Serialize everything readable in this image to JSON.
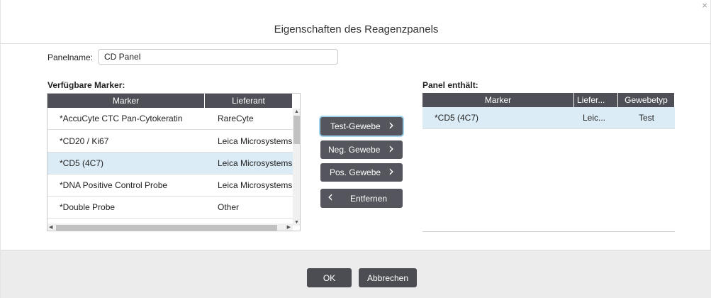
{
  "dialog": {
    "title": "Eigenschaften des Reagenzpanels",
    "close_glyph": "×"
  },
  "panel_name": {
    "label": "Panelname:",
    "value": "CD Panel"
  },
  "available": {
    "label": "Verfügbare Marker:",
    "columns": [
      "Marker",
      "Lieferant"
    ],
    "rows": [
      {
        "marker": "*AccuCyte CTC Pan-Cytokeratin",
        "supplier": "RareCyte",
        "selected": false
      },
      {
        "marker": "*CD20 / Ki67",
        "supplier": "Leica Microsystems",
        "selected": false
      },
      {
        "marker": "*CD5 (4C7)",
        "supplier": "Leica Microsystems",
        "selected": true
      },
      {
        "marker": "*DNA Positive Control Probe",
        "supplier": "Leica Microsystems",
        "selected": false
      },
      {
        "marker": "*Double Probe",
        "supplier": "Other",
        "selected": false
      }
    ]
  },
  "actions": {
    "test": "Test-Gewebe",
    "neg": "Neg. Gewebe",
    "pos": "Pos. Gewebe",
    "remove": "Entfernen",
    "right_chevron": "›",
    "left_chevron": "‹"
  },
  "panel_contains": {
    "label": "Panel enthält:",
    "columns": [
      "Marker",
      "Liefer...",
      "Gewebetyp"
    ],
    "rows": [
      {
        "marker": "*CD5 (4C7)",
        "supplier": "Leic...",
        "tissue": "Test",
        "selected": true
      }
    ]
  },
  "footer": {
    "ok": "OK",
    "cancel": "Abbrechen"
  },
  "colors": {
    "header_bg": "#4f5057",
    "button_bg": "#55565d",
    "selected_row": "#dcecf6",
    "focus_ring": "#9fd3ee",
    "footer_bg": "#ececec"
  },
  "icons": [
    "close-icon",
    "chevron-right-icon",
    "chevron-left-icon",
    "scroll-up-icon",
    "scroll-down-icon",
    "scroll-left-icon",
    "scroll-right-icon"
  ]
}
